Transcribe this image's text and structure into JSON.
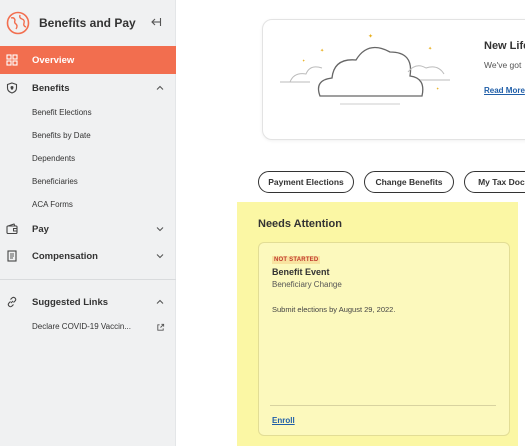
{
  "sidebar": {
    "title": "Benefits and Pay",
    "items": [
      {
        "label": "Overview"
      },
      {
        "label": "Benefits"
      },
      {
        "label": "Pay"
      },
      {
        "label": "Compensation"
      },
      {
        "label": "Suggested Links"
      }
    ],
    "benefits_sub": [
      "Benefit Elections",
      "Benefits by Date",
      "Dependents",
      "Beneficiaries",
      "ACA Forms"
    ],
    "suggested_links": [
      "Declare COVID-19 Vaccin..."
    ],
    "colors": {
      "active": "#f26e4f"
    }
  },
  "banner": {
    "heading": "New Life",
    "text": "We've got",
    "link": "Read More"
  },
  "actions": [
    "Payment Elections",
    "Change Benefits",
    "My Tax Docu"
  ],
  "needs_attention": {
    "title": "Needs Attention",
    "task": {
      "status": "NOT STARTED",
      "title": "Benefit Event",
      "subtitle": "Beneficiary Change",
      "description": "Submit elections by August 29, 2022.",
      "action": "Enroll"
    },
    "colors": {
      "highlight": "#fbf7a4",
      "status": "#c0392b"
    }
  }
}
